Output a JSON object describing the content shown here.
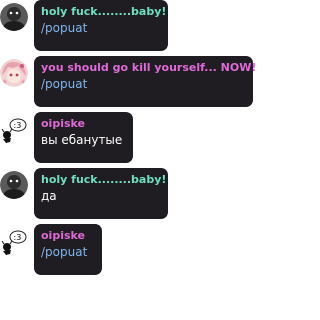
{
  "messages": [
    {
      "author": "holy fuck........baby!",
      "author_color": "#6fe0c0",
      "text": "/popuat",
      "is_command": true,
      "avatar": "dark-avatar"
    },
    {
      "author": "you should go kill yourself... NOW!",
      "author_color": "#e06ad8",
      "text": "/popuat",
      "is_command": true,
      "avatar": "anime-girl-avatar"
    },
    {
      "author": "oipiske",
      "author_color": "#e06ad8",
      "text": "вы ебанутые",
      "is_command": false,
      "avatar": "doodle-avatar"
    },
    {
      "author": "holy fuck........baby!",
      "author_color": "#6fe0c0",
      "text": "да",
      "is_command": false,
      "avatar": "dark-avatar"
    },
    {
      "author": "oipiske",
      "author_color": "#e06ad8",
      "text": "/popuat",
      "is_command": true,
      "avatar": "doodle-avatar"
    }
  ]
}
